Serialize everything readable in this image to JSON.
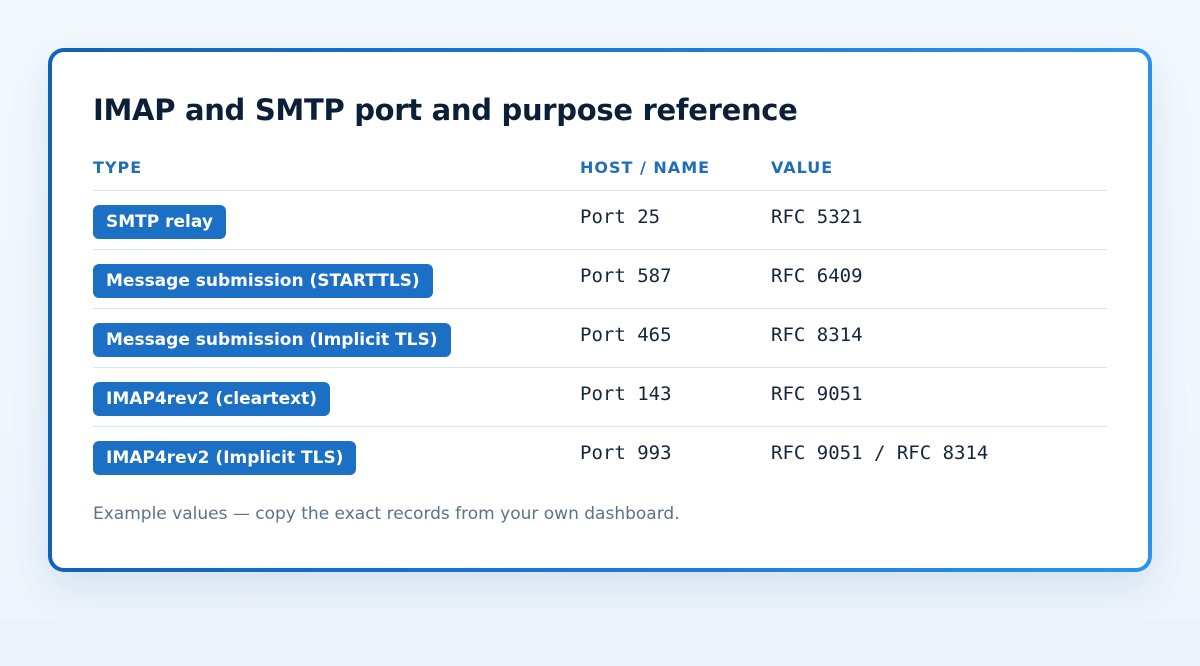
{
  "card": {
    "title": "IMAP and SMTP port and purpose reference",
    "footnote": "Example values — copy the exact records from your own dashboard."
  },
  "table": {
    "columns": [
      "TYPE",
      "HOST / NAME",
      "VALUE"
    ],
    "rows": [
      {
        "type": "SMTP relay",
        "host": "Port 25",
        "value": "RFC 5321"
      },
      {
        "type": "Message submission (STARTTLS)",
        "host": "Port 587",
        "value": "RFC 6409"
      },
      {
        "type": "Message submission (Implicit TLS)",
        "host": "Port 465",
        "value": "RFC 8314"
      },
      {
        "type": "IMAP4rev2 (cleartext)",
        "host": "Port 143",
        "value": "RFC 9051"
      },
      {
        "type": "IMAP4rev2 (Implicit TLS)",
        "host": "Port 993",
        "value": "RFC 9051 / RFC 8314"
      }
    ]
  },
  "colors": {
    "card_border_start": "#0f63b8",
    "card_border_end": "#2b93ec",
    "pill_background": "#1b6fc4",
    "header_text": "#1f6fb8",
    "title_text": "#0c1f38"
  }
}
